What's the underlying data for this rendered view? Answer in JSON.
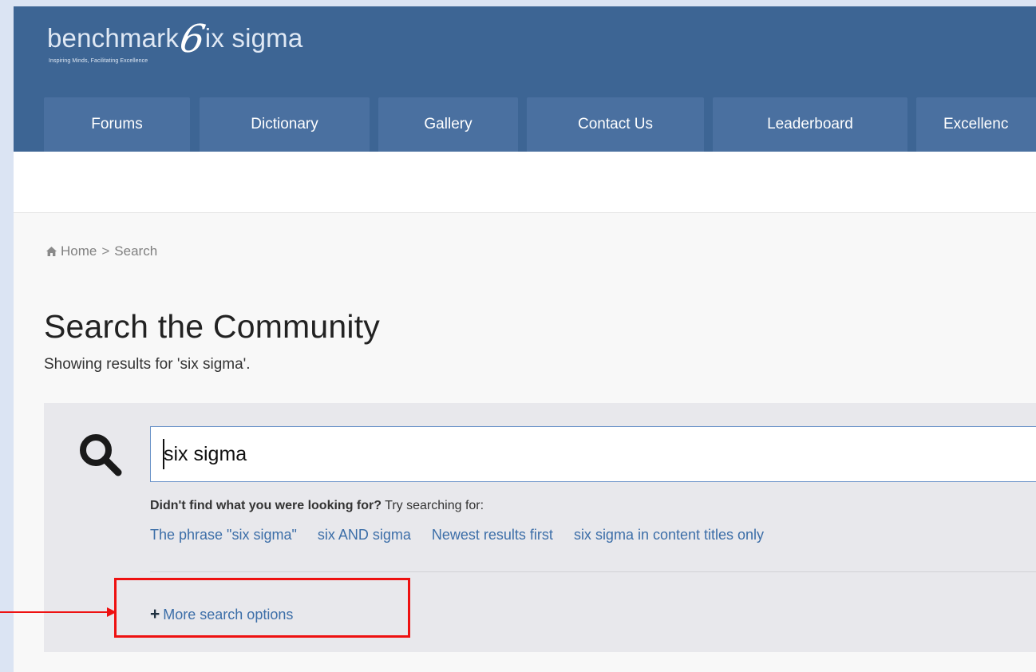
{
  "logo": {
    "wordmark_left": "benchmark",
    "wordmark_six": "6",
    "wordmark_right": "ix sigma",
    "tagline": "Inspiring Minds, Facilitating Excellence"
  },
  "nav": {
    "items": [
      {
        "label": "Forums"
      },
      {
        "label": "Dictionary"
      },
      {
        "label": "Gallery"
      },
      {
        "label": "Contact Us"
      },
      {
        "label": "Leaderboard"
      },
      {
        "label": "Excellenc"
      }
    ]
  },
  "breadcrumb": {
    "home": "Home",
    "separator": ">",
    "current": "Search"
  },
  "page": {
    "title": "Search the Community",
    "results_text": "Showing results for 'six sigma'."
  },
  "search": {
    "value": "six sigma",
    "didnt_find_bold": "Didn't find what you were looking for?",
    "didnt_find_rest": " Try searching for:",
    "suggestions": [
      "The phrase \"six sigma\"",
      "six AND sigma",
      "Newest results first",
      "six sigma in content titles only"
    ],
    "more_options": "More search options",
    "plus_icon": "+"
  },
  "colors": {
    "header": "#3d6594",
    "nav_tab": "#4a70a0",
    "link": "#3c6ea8",
    "highlight": "#ee1111",
    "outer_background": "#dbe4f3"
  }
}
